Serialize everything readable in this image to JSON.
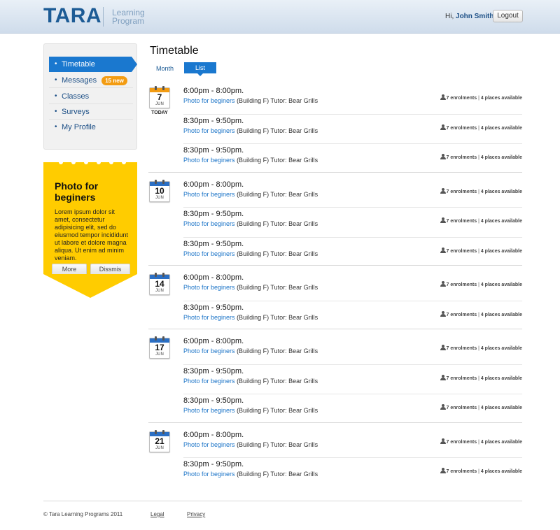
{
  "header": {
    "logo": "TARA",
    "logo_sub_1": "Learning",
    "logo_sub_2": "Program",
    "greeting_prefix": "Hi,",
    "user_name": "John Smith",
    "logout_label": "Logout"
  },
  "sidebar": {
    "items": [
      {
        "label": "Timetable",
        "active": true
      },
      {
        "label": "Messages",
        "badge": "15 new"
      },
      {
        "label": "Classes"
      },
      {
        "label": "Surveys"
      },
      {
        "label": "My Profile"
      }
    ]
  },
  "promo": {
    "title": "Photo for beginers",
    "body": "Lorem ipsum dolor sit amet, consectetur adipisicing elit, sed do eiusmod tempor incididunt ut labore et dolore magna aliqua. Ut enim ad minim veniam.",
    "more_label": "More",
    "dismiss_label": "Dissmis"
  },
  "main": {
    "title": "Timetable",
    "tabs": [
      {
        "label": "Month"
      },
      {
        "label": "List",
        "active": true
      }
    ],
    "days": [
      {
        "day": "7",
        "month": "JUN",
        "today_label": "TODAY",
        "is_today": true,
        "sessions": [
          {
            "time": "6:00pm - 8:00pm.",
            "course": "Photo for beginers",
            "details": "(Building F) Tutor: Bear Grills",
            "enrolments": "7 enrolments",
            "places": "4 places available"
          },
          {
            "time": "8:30pm - 9:50pm.",
            "course": "Photo for beginers",
            "details": "(Building F) Tutor: Bear Grills",
            "enrolments": "7 enrolments",
            "places": "4 places available"
          },
          {
            "time": "8:30pm - 9:50pm.",
            "course": "Photo for beginers",
            "details": "(Building F) Tutor: Bear Grills",
            "enrolments": "7 enrolments",
            "places": "4 places available"
          }
        ]
      },
      {
        "day": "10",
        "month": "JUN",
        "sessions": [
          {
            "time": "6:00pm - 8:00pm.",
            "course": "Photo for beginers",
            "details": "(Building F) Tutor: Bear Grills",
            "enrolments": "7 enrolments",
            "places": "4 places available"
          },
          {
            "time": "8:30pm - 9:50pm.",
            "course": "Photo for beginers",
            "details": "(Building F) Tutor: Bear Grills",
            "enrolments": "7 enrolments",
            "places": "4 places available"
          },
          {
            "time": "8:30pm - 9:50pm.",
            "course": "Photo for beginers",
            "details": "(Building F) Tutor: Bear Grills",
            "enrolments": "7 enrolments",
            "places": "4 places available"
          }
        ]
      },
      {
        "day": "14",
        "month": "JUN",
        "sessions": [
          {
            "time": "6:00pm - 8:00pm.",
            "course": "Photo for beginers",
            "details": "(Building F) Tutor: Bear Grills",
            "enrolments": "7 enrolments",
            "places": "4 places available"
          },
          {
            "time": "8:30pm - 9:50pm.",
            "course": "Photo for beginers",
            "details": "(Building F) Tutor: Bear Grills",
            "enrolments": "7 enrolments",
            "places": "4 places available"
          }
        ]
      },
      {
        "day": "17",
        "month": "JUN",
        "sessions": [
          {
            "time": "6:00pm - 8:00pm.",
            "course": "Photo for beginers",
            "details": "(Building F) Tutor: Bear Grills",
            "enrolments": "7 enrolments",
            "places": "4 places available"
          },
          {
            "time": "8:30pm - 9:50pm.",
            "course": "Photo for beginers",
            "details": "(Building F) Tutor: Bear Grills",
            "enrolments": "7 enrolments",
            "places": "4 places available"
          },
          {
            "time": "8:30pm - 9:50pm.",
            "course": "Photo for beginers",
            "details": "(Building F) Tutor: Bear Grills",
            "enrolments": "7 enrolments",
            "places": "4 places available"
          }
        ]
      },
      {
        "day": "21",
        "month": "JUN",
        "sessions": [
          {
            "time": "6:00pm - 8:00pm.",
            "course": "Photo for beginers",
            "details": "(Building F) Tutor: Bear Grills",
            "enrolments": "7 enrolments",
            "places": "4 places available"
          },
          {
            "time": "8:30pm - 9:50pm.",
            "course": "Photo for beginers",
            "details": "(Building F) Tutor: Bear Grills",
            "enrolments": "7 enrolments",
            "places": "4 places available"
          }
        ]
      }
    ]
  },
  "footer": {
    "copyright": "© Tara Learning Programs 2011",
    "legal_label": "Legal",
    "privacy_label": "Privacy"
  },
  "colors": {
    "brand": "#1c5b95",
    "accent": "#1a78cf",
    "promo": "#ffcc00",
    "badge": "#f39c12"
  }
}
